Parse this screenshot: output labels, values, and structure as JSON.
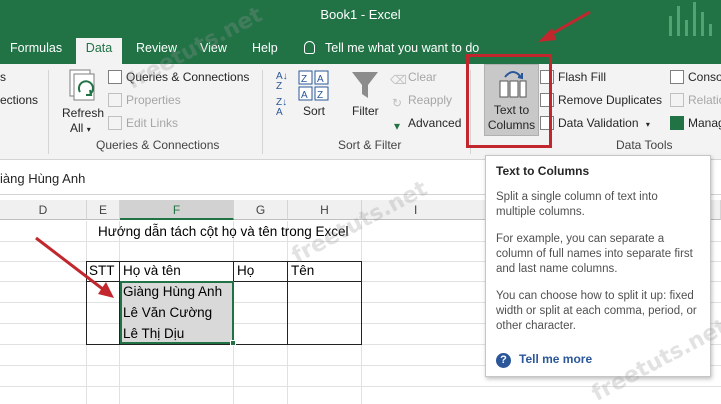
{
  "window": {
    "title": "Book1  -  Excel"
  },
  "tabs": [
    {
      "label": "Formulas"
    },
    {
      "label": "Data",
      "active": true
    },
    {
      "label": "Review"
    },
    {
      "label": "View"
    },
    {
      "label": "Help"
    }
  ],
  "tell_me": {
    "label": "Tell me what you want to do"
  },
  "ribbon": {
    "get_data": {
      "line1": "s",
      "line2": "ections"
    },
    "refresh_all": {
      "line1": "Refresh",
      "line2": "All"
    },
    "queries": {
      "queries_connections": "Queries & Connections",
      "properties": "Properties",
      "edit_links": "Edit Links",
      "group_label": "Queries & Connections"
    },
    "sort_filter": {
      "sort": "Sort",
      "filter": "Filter",
      "clear": "Clear",
      "reapply": "Reapply",
      "advanced": "Advanced",
      "group_label": "Sort & Filter"
    },
    "data_tools": {
      "text_to_columns_line1": "Text to",
      "text_to_columns_line2": "Columns",
      "flash_fill": "Flash Fill",
      "remove_duplicates": "Remove Duplicates",
      "data_validation": "Data Validation",
      "consolidate": "Conso",
      "relationships": "Relatio",
      "manage": "Manag",
      "group_label": "Data Tools"
    }
  },
  "formula_bar": {
    "content": "iàng Hùng Anh"
  },
  "columns": [
    "D",
    "E",
    "F",
    "G",
    "H",
    "I"
  ],
  "sheet": {
    "title": "Hướng dẫn tách cột họ và tên trong Excel",
    "headers": {
      "stt": "STT",
      "ho_va_ten": "Họ và tên",
      "ho": "Họ",
      "ten": "Tên"
    },
    "names": [
      "Giàng Hùng Anh",
      "Lê Văn Cường",
      "Lê Thị Dịu"
    ]
  },
  "tooltip": {
    "title": "Text to Columns",
    "p1": "Split a single column of text into multiple columns.",
    "p2": "For example, you can separate a column of full names into separate first and last name columns.",
    "p3": "You can choose how to split it up: fixed width or split at each comma, period, or other character.",
    "link": "Tell me more"
  },
  "watermark": "freetuts.net",
  "colors": {
    "excel_green": "#217346",
    "annotation_red": "#c1272d",
    "link_blue": "#2b579a"
  }
}
